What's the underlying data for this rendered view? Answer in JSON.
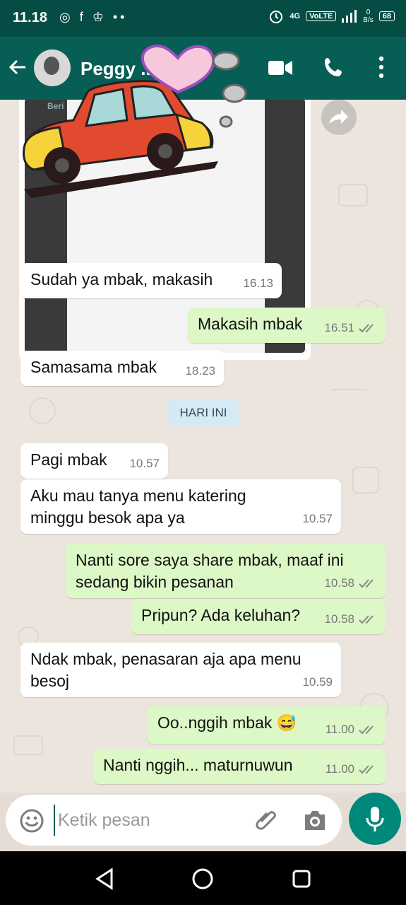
{
  "status_bar": {
    "time": "11.18",
    "left_icons": "◎ f ♔ ••",
    "network": "4G",
    "volte": "VoLTE",
    "speed_value": "0",
    "speed_unit": "B/s",
    "battery": "68"
  },
  "header": {
    "back_icon": "arrow-left-icon",
    "contact_name": "Peggy ... Wu...",
    "icons": [
      "video-call-icon",
      "phone-icon",
      "more-vertical-icon"
    ]
  },
  "chat": {
    "image_message": {
      "time": "16.13",
      "doc_hint": "Beri"
    },
    "messages": [
      {
        "dir": "in",
        "text": "Sudah ya mbak, makasih",
        "time": "16.13"
      },
      {
        "dir": "out",
        "text": "Makasih mbak",
        "time": "16.51"
      },
      {
        "dir": "in",
        "text": "Samasama mbak",
        "time": "18.23"
      },
      {
        "dir": "in",
        "text": "Pagi mbak",
        "time": "10.57"
      },
      {
        "dir": "in",
        "text": "Aku mau tanya menu katering minggu besok apa ya",
        "time": "10.57"
      },
      {
        "dir": "out",
        "text": "Nanti sore saya share mbak, maaf ini sedang bikin pesanan",
        "time": "10.58"
      },
      {
        "dir": "out",
        "text": "Pripun? Ada keluhan?",
        "time": "10.58"
      },
      {
        "dir": "in",
        "text": "Ndak mbak, penasaran aja apa menu besoj",
        "time": "10.59"
      },
      {
        "dir": "out",
        "text": "Oo..nggih mbak 😅",
        "time": "11.00"
      },
      {
        "dir": "out",
        "text": "Nanti nggih... maturnuwun",
        "time": "11.00"
      }
    ],
    "date_separator": "HARI INI"
  },
  "input": {
    "placeholder": "Ketik pesan",
    "value": ""
  },
  "colors": {
    "header": "#075e54",
    "status_bar": "#054d44",
    "outgoing_bubble": "#dcf8c6",
    "incoming_bubble": "#ffffff",
    "accent": "#00897b"
  }
}
